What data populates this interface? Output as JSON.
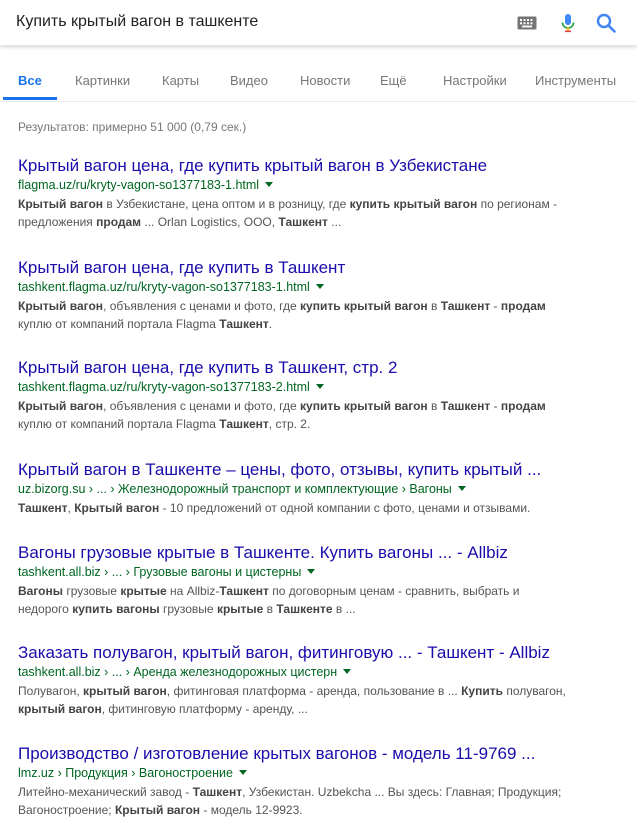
{
  "search": {
    "query": "Купить крытый вагон в ташкенте"
  },
  "tabs": [
    {
      "label": "Все"
    },
    {
      "label": "Картинки"
    },
    {
      "label": "Карты"
    },
    {
      "label": "Видео"
    },
    {
      "label": "Новости"
    },
    {
      "label": "Ещё"
    },
    {
      "label": "Настройки"
    },
    {
      "label": "Инструменты"
    }
  ],
  "stats": "Результатов: примерно 51 000 (0,79 сек.)",
  "colors": {
    "accent": "#1a73e8",
    "link": "#1a0dab",
    "url": "#006621",
    "snippet": "#545454"
  },
  "icons": [
    "keyboard-icon",
    "microphone-icon",
    "search-icon",
    "dropdown-caret-icon"
  ],
  "results": [
    {
      "title": "Крытый вагон цена, где купить крытый вагон в Узбекистане",
      "url": "flagma.uz/ru/kryty-vagon-so1377183-1.html",
      "snippet": [
        [
          {
            "t": "Крытый вагон",
            "b": true
          },
          {
            "t": " в Узбекистане, цена оптом и в розницу, где "
          },
          {
            "t": "купить крытый вагон",
            "b": true
          },
          {
            "t": " по регионам -"
          }
        ],
        [
          {
            "t": "предложения "
          },
          {
            "t": "продам",
            "b": true
          },
          {
            "t": " ... Orlan Logistics, ООО, "
          },
          {
            "t": "Ташкент",
            "b": true
          },
          {
            "t": " ..."
          }
        ]
      ]
    },
    {
      "title": "Крытый вагон цена, где купить в Ташкент",
      "url": "tashkent.flagma.uz/ru/kryty-vagon-so1377183-1.html",
      "snippet": [
        [
          {
            "t": "Крытый вагон",
            "b": true
          },
          {
            "t": ", объявления с ценами и фото, где "
          },
          {
            "t": "купить крытый вагон",
            "b": true
          },
          {
            "t": " в "
          },
          {
            "t": "Ташкент",
            "b": true
          },
          {
            "t": " - "
          },
          {
            "t": "продам",
            "b": true
          }
        ],
        [
          {
            "t": "куплю от компаний портала Flagma "
          },
          {
            "t": "Ташкент",
            "b": true
          },
          {
            "t": "."
          }
        ]
      ]
    },
    {
      "title": "Крытый вагон цена, где купить в Ташкент, стр. 2",
      "url": "tashkent.flagma.uz/ru/kryty-vagon-so1377183-2.html",
      "snippet": [
        [
          {
            "t": "Крытый вагон",
            "b": true
          },
          {
            "t": ", объявления с ценами и фото, где "
          },
          {
            "t": "купить крытый вагон",
            "b": true
          },
          {
            "t": " в "
          },
          {
            "t": "Ташкент",
            "b": true
          },
          {
            "t": " - "
          },
          {
            "t": "продам",
            "b": true
          }
        ],
        [
          {
            "t": "куплю от компаний портала Flagma "
          },
          {
            "t": "Ташкент",
            "b": true
          },
          {
            "t": ", стр. 2."
          }
        ]
      ]
    },
    {
      "title": "Крытый вагон в Ташкенте – цены, фото, отзывы, купить крытый ...",
      "url": "uz.bizorg.su",
      "crumbs": [
        "...",
        "Железнодорожный транспорт и комплектующие",
        "Вагоны"
      ],
      "snippet": [
        [
          {
            "t": "Ташкент",
            "b": true
          },
          {
            "t": ", "
          },
          {
            "t": "Крытый вагон",
            "b": true
          },
          {
            "t": " - 10 предложений от одной компании с фото, ценами и отзывами."
          }
        ]
      ]
    },
    {
      "title": "Вагоны грузовые крытые в Ташкенте. Купить вагоны ... - Allbiz",
      "url": "tashkent.all.biz",
      "crumbs": [
        "...",
        "Грузовые вагоны и цистерны"
      ],
      "snippet": [
        [
          {
            "t": "Вагоны",
            "b": true
          },
          {
            "t": " грузовые "
          },
          {
            "t": "крытые",
            "b": true
          },
          {
            "t": " на Allbiz-"
          },
          {
            "t": "Ташкент",
            "b": true
          },
          {
            "t": " по договорным ценам - сравнить, выбрать и"
          }
        ],
        [
          {
            "t": "недорого "
          },
          {
            "t": "купить вагоны",
            "b": true
          },
          {
            "t": " грузовые "
          },
          {
            "t": "крытые",
            "b": true
          },
          {
            "t": " в "
          },
          {
            "t": "Ташкенте",
            "b": true
          },
          {
            "t": " в ..."
          }
        ]
      ]
    },
    {
      "title": "Заказать полувагон, крытый вагон, фитинговую ... - Ташкент - Allbiz",
      "url": "tashkent.all.biz",
      "crumbs": [
        "...",
        "Аренда железнодорожных цистерн"
      ],
      "snippet": [
        [
          {
            "t": "Полувагон, "
          },
          {
            "t": "крытый вагон",
            "b": true
          },
          {
            "t": ", фитинговая платформа - аренда, пользование в ... "
          },
          {
            "t": "Купить",
            "b": true
          },
          {
            "t": " полувагон,"
          }
        ],
        [
          {
            "t": "крытый вагон",
            "b": true
          },
          {
            "t": ", фитинговую платформу - аренду, ..."
          }
        ]
      ]
    },
    {
      "title": "Производство / изготовление крытых вагонов - модель 11-9769 ...",
      "url": "lmz.uz",
      "crumbs": [
        "Продукция",
        "Вагоностроение"
      ],
      "snippet": [
        [
          {
            "t": "Литейно-механический завод - "
          },
          {
            "t": "Ташкент",
            "b": true
          },
          {
            "t": ", Узбекистан. Uzbekcha ... Вы здесь: Главная; Продукция;"
          }
        ],
        [
          {
            "t": "Вагоностроение; "
          },
          {
            "t": "Крытый вагон",
            "b": true
          },
          {
            "t": " - модель 12-9923."
          }
        ]
      ]
    }
  ]
}
